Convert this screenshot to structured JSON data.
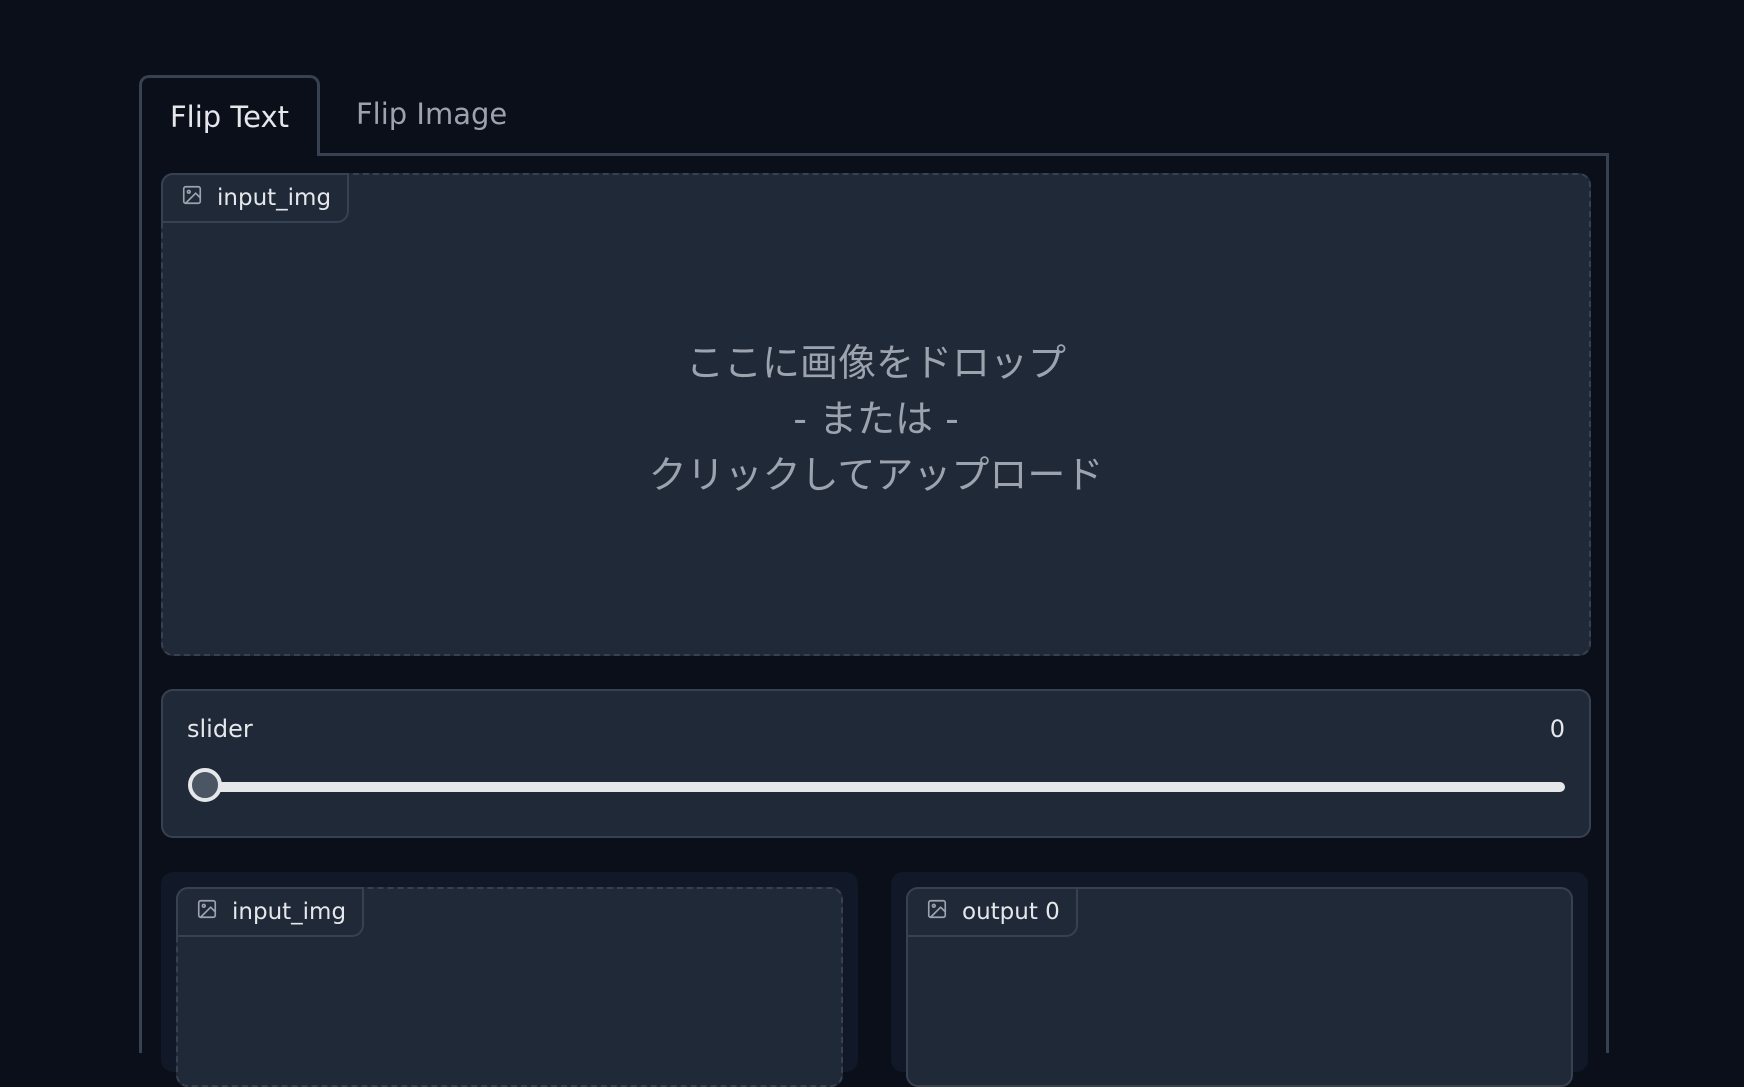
{
  "tabs": [
    {
      "label": "Flip Text",
      "active": true
    },
    {
      "label": "Flip Image",
      "active": false
    }
  ],
  "upload": {
    "label": "input_img",
    "icon": "image-icon",
    "drop_line1": "ここに画像をドロップ",
    "drop_line2": "- または -",
    "drop_line3": "クリックしてアップロード"
  },
  "slider": {
    "label": "slider",
    "value": "0"
  },
  "bottom": {
    "left_label": "input_img",
    "right_label": "output 0"
  },
  "colors": {
    "background": "#0b0f19",
    "block": "#1f2937",
    "border": "#374151",
    "text": "#e5e7eb",
    "muted": "#9ca3af"
  }
}
